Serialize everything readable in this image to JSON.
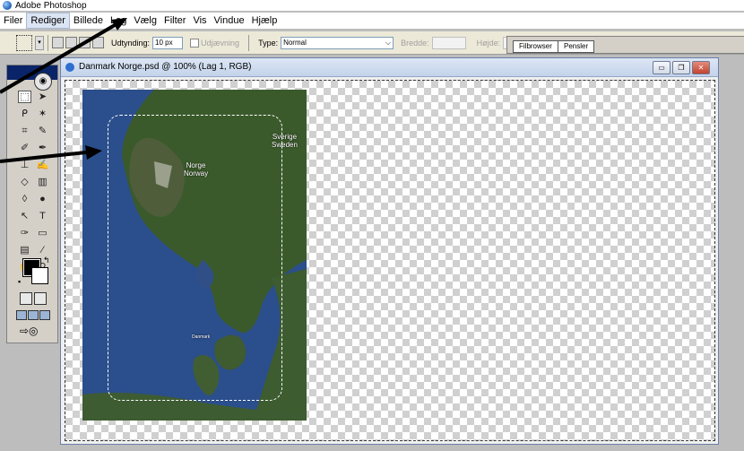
{
  "app": {
    "title": "Adobe Photoshop"
  },
  "menu": [
    "Filer",
    "Rediger",
    "Billede",
    "Lag",
    "Vælg",
    "Filter",
    "Vis",
    "Vindue",
    "Hjælp"
  ],
  "options": {
    "feather_label": "Udtynding:",
    "feather_value": "10 px",
    "antialias_label": "Udjævning",
    "type_label": "Type:",
    "type_value": "Normal",
    "width_label": "Bredde:",
    "height_label": "Højde:"
  },
  "palette_well": {
    "tabs": [
      "Filbrowser",
      "Pensler"
    ]
  },
  "document": {
    "title": "Danmark Norge.psd @ 100% (Lag 1, RGB)",
    "controls": {
      "minimize": "▭",
      "restore": "❐",
      "close": "✕"
    }
  },
  "map_labels": {
    "sweden": [
      "Sverige",
      "Sweden"
    ],
    "norway": [
      "Norge",
      "Norway"
    ],
    "denmark": "Danmark"
  },
  "colors": {
    "sea": "#2d4f8f",
    "land": "#3f5a2e",
    "arrow": "#000000"
  }
}
